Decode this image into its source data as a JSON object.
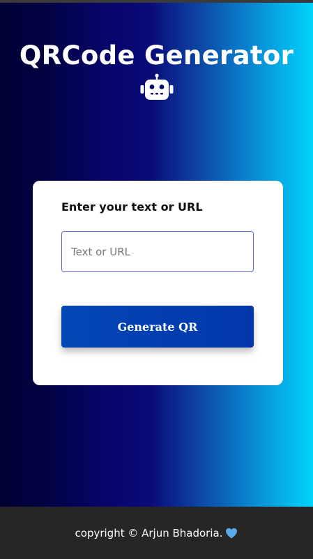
{
  "header": {
    "title": "QRCode Generator",
    "icon": "robot-icon"
  },
  "form": {
    "label": "Enter your text or URL",
    "input_placeholder": "Text or URL",
    "input_value": "",
    "button_label": "Generate QR"
  },
  "footer": {
    "text": "copyright © Arjun Bhadoria.",
    "icon": "heart-icon",
    "heart_color": "#5aa9e6"
  },
  "colors": {
    "gradient_start": "#000033",
    "gradient_mid": "#0a0b78",
    "gradient_end": "#00d4fb",
    "button": "#0347b5",
    "input_border": "#5b63d3"
  }
}
